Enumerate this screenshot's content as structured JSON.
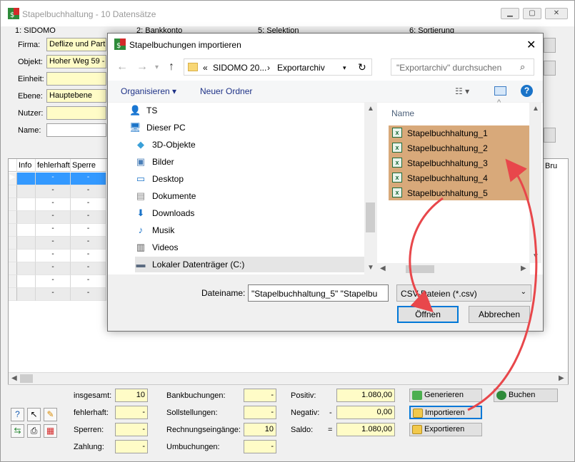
{
  "main_window": {
    "title": "Stapelbuchhaltung - 10 Datensätze",
    "controls": {
      "minimize": "▁",
      "maximize": "▢",
      "close": "✕"
    },
    "tabs": [
      "1: SIDOMO",
      "2: Bankkonto",
      "5: Selektion",
      "6: Sortierung"
    ],
    "form": {
      "firma_label": "Firma:",
      "firma_value": "Deflize und Partr",
      "objekt_label": "Objekt:",
      "objekt_value": "Hoher Weg 59 -",
      "einheit_label": "Einheit:",
      "einheit_value": "",
      "ebene_label": "Ebene:",
      "ebene_value": "Hauptebene",
      "nutzer_label": "Nutzer:",
      "nutzer_value": "",
      "name_label": "Name:",
      "name_value": ""
    },
    "grid": {
      "columns": [
        "Info",
        "fehlerhaft",
        "Sperre"
      ],
      "right_column": "Bru",
      "row_count": 10,
      "cell_placeholder": "-"
    },
    "stats": {
      "insgesamt_label": "insgesamt:",
      "insgesamt_value": "10",
      "fehlerhaft_label": "fehlerhaft:",
      "fehlerhaft_value": "-",
      "sperren_label": "Sperren:",
      "sperren_value": "-",
      "zahlung_label": "Zahlung:",
      "zahlung_value": "-",
      "bankbuchungen_label": "Bankbuchungen:",
      "bankbuchungen_value": "-",
      "sollstellungen_label": "Sollstellungen:",
      "sollstellungen_value": "-",
      "rechnungseingaenge_label": "Rechnungseingänge:",
      "rechnungseingaenge_value": "10",
      "umbuchungen_label": "Umbuchungen:",
      "umbuchungen_value": "-"
    },
    "totals": {
      "positiv_label": "Positiv:",
      "positiv_value": "1.080,00",
      "negativ_label": "Negativ:",
      "negativ_sign": "-",
      "negativ_value": "0,00",
      "saldo_label": "Saldo:",
      "saldo_sign": "=",
      "saldo_value": "1.080,00"
    },
    "actions": {
      "generieren": "Generieren",
      "importieren": "Importieren",
      "exportieren": "Exportieren",
      "buchen": "Buchen"
    }
  },
  "dialog": {
    "title": "Stapelbuchungen importieren",
    "close": "✕",
    "breadcrumb": {
      "prefix": "«",
      "part1": "SIDOMO 20...",
      "sep": "›",
      "part2": "Exportarchiv"
    },
    "search_placeholder": "\"Exportarchiv\" durchsuchen",
    "organize": "Organisieren",
    "new_folder": "Neuer Ordner",
    "tree": [
      {
        "label": "TS",
        "icon": "user-icon"
      },
      {
        "label": "Dieser PC",
        "icon": "computer-icon"
      },
      {
        "label": "3D-Objekte",
        "icon": "cube-icon"
      },
      {
        "label": "Bilder",
        "icon": "pictures-icon"
      },
      {
        "label": "Desktop",
        "icon": "desktop-icon"
      },
      {
        "label": "Dokumente",
        "icon": "documents-icon"
      },
      {
        "label": "Downloads",
        "icon": "downloads-icon"
      },
      {
        "label": "Musik",
        "icon": "music-icon"
      },
      {
        "label": "Videos",
        "icon": "videos-icon"
      },
      {
        "label": "Lokaler Datenträger (C:)",
        "icon": "drive-icon"
      }
    ],
    "column_name": "Name",
    "files": [
      "Stapelbuchhaltung_1",
      "Stapelbuchhaltung_2",
      "Stapelbuchhaltung_3",
      "Stapelbuchhaltung_4",
      "Stapelbuchhaltung_5"
    ],
    "filename_label": "Dateiname:",
    "filename_value": "\"Stapelbuchhaltung_5\" \"Stapelbu",
    "filetype_value": "CSV-Dateien (*.csv)",
    "open_button": "Öffnen",
    "cancel_button": "Abbrechen"
  },
  "colors": {
    "selection": "#3399ff",
    "file_highlight": "#d8a97a",
    "arrow": "#e8474b",
    "input_yellow": "#fffcc7"
  }
}
